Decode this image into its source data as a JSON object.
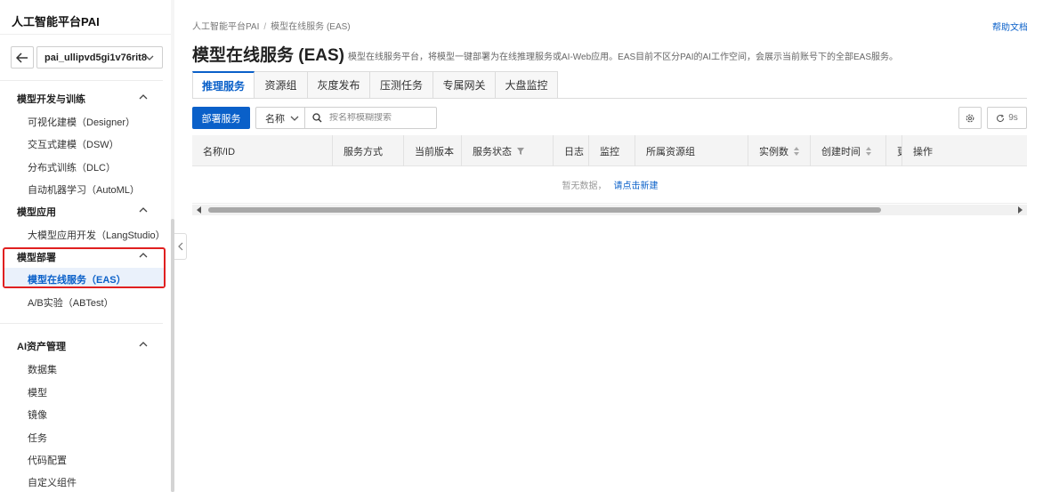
{
  "sidebar": {
    "brand": "人工智能平台PAI",
    "workspace": "pai_ullipvd5gi1v76rit8",
    "groups": [
      {
        "title": "模型开发与训练",
        "items": [
          "可视化建模（Designer）",
          "交互式建模（DSW）",
          "分布式训练（DLC）",
          "自动机器学习（AutoML）"
        ]
      },
      {
        "title": "模型应用",
        "items": [
          "大模型应用开发（LangStudio）"
        ]
      },
      {
        "title": "模型部署",
        "items": [
          "模型在线服务（EAS）",
          "A/B实验（ABTest）"
        ]
      },
      {
        "title": "AI资产管理",
        "items": [
          "数据集",
          "模型",
          "镜像",
          "任务",
          "代码配置",
          "自定义组件"
        ]
      }
    ]
  },
  "breadcrumb": [
    "人工智能平台PAI",
    "/",
    "模型在线服务 (EAS)"
  ],
  "help_link": "帮助文档",
  "page": {
    "title": "模型在线服务 (EAS)",
    "description": "模型在线服务平台，将模型一键部署为在线推理服务或AI-Web应用。EAS目前不区分PAI的AI工作空间，会展示当前账号下的全部EAS服务。"
  },
  "tabs": [
    "推理服务",
    "资源组",
    "灰度发布",
    "压测任务",
    "专属网关",
    "大盘监控"
  ],
  "toolbar": {
    "deploy_label": "部署服务",
    "filter_value": "名称",
    "search_placeholder": "按名称模糊搜索",
    "refresh_label": "9s"
  },
  "table": {
    "columns": [
      "名称/ID",
      "服务方式",
      "当前版本",
      "服务状态",
      "日志",
      "监控",
      "所属资源组",
      "实例数",
      "创建时间",
      "更",
      "操作"
    ],
    "empty_text": "暂无数据，",
    "empty_link": "请点击新建"
  },
  "colors": {
    "accent": "#0a60c9",
    "highlight": "#e02020"
  }
}
